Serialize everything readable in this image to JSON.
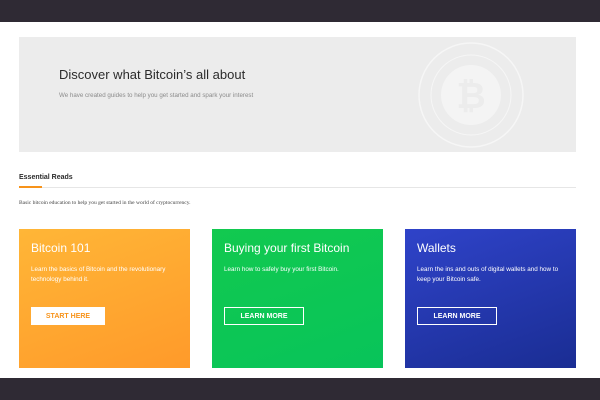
{
  "hero": {
    "title": "Discover what Bitcoin’s all about",
    "subtitle": "We have created guides to help you get started and spark your interest",
    "watermark_icon": "bitcoin-icon"
  },
  "section": {
    "tab": "Essential Reads",
    "description": "Basic bitcoin education to help you get started in the world of cryptocurrency.",
    "accent_color": "#f7931a"
  },
  "cards": [
    {
      "title": "Bitcoin 101",
      "text": "Learn the basics of Bitcoin and the revolutionary technology behind it.",
      "button": "START HERE",
      "color": "#ffa833"
    },
    {
      "title": "Buying your first Bitcoin",
      "text": "Learn how to safely buy your first Bitcoin.",
      "button": "LEARN MORE",
      "color": "#0ec653"
    },
    {
      "title": "Wallets",
      "text": "Learn the ins and outs of digital wallets and how to keep your Bitcoin safe.",
      "button": "LEARN MORE",
      "color": "#2438b0"
    }
  ]
}
